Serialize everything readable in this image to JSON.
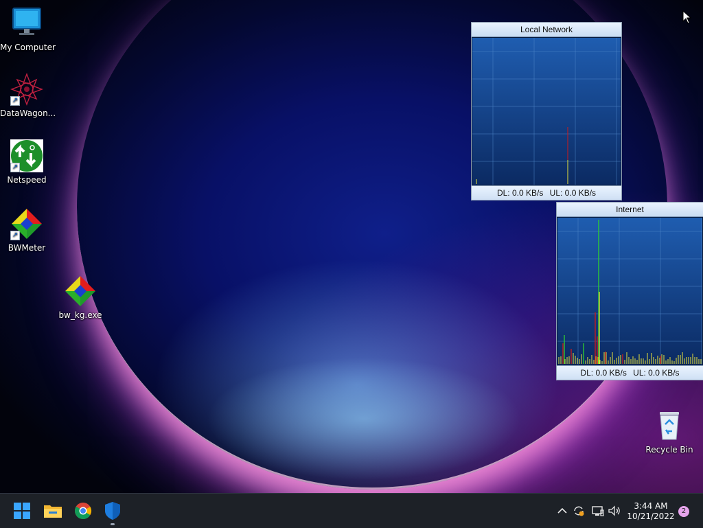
{
  "desktop": {
    "icons": [
      {
        "label": "My Computer",
        "icon": "monitor-icon",
        "shortcut": false
      },
      {
        "label": "DataWagon...",
        "icon": "datawagon-icon",
        "shortcut": true
      },
      {
        "label": "Netspeed",
        "icon": "netspeed-icon",
        "shortcut": true
      },
      {
        "label": "BWMeter",
        "icon": "bwmeter-icon",
        "shortcut": true
      },
      {
        "label": "bw_kg.exe",
        "icon": "bwmeter-icon",
        "shortcut": false
      },
      {
        "label": "Recycle Bin",
        "icon": "recycle-bin-icon",
        "shortcut": false
      }
    ]
  },
  "meters": {
    "local": {
      "title": "Local Network",
      "dl": "DL: 0.0 KB/s",
      "ul": "UL: 0.0 KB/s"
    },
    "internet": {
      "title": "Internet",
      "dl": "DL: 0.0 KB/s",
      "ul": "UL: 0.0 KB/s"
    }
  },
  "colors": {
    "download": "#d01a1a",
    "upload": "#e7e23a",
    "total": "#2fd12f",
    "graph_grid": "#4f86c8"
  },
  "taskbar": {
    "apps": [
      {
        "name": "Start",
        "icon": "windows-start-icon"
      },
      {
        "name": "File Explorer",
        "icon": "folder-icon"
      },
      {
        "name": "Google Chrome",
        "icon": "chrome-icon"
      },
      {
        "name": "Windows Security",
        "icon": "shield-icon"
      }
    ],
    "tray": {
      "icons": [
        "chevron-up-icon",
        "sync-icon",
        "network-icon",
        "volume-icon"
      ],
      "time": "3:44 AM",
      "date": "10/21/2022",
      "notifications": "2"
    }
  }
}
